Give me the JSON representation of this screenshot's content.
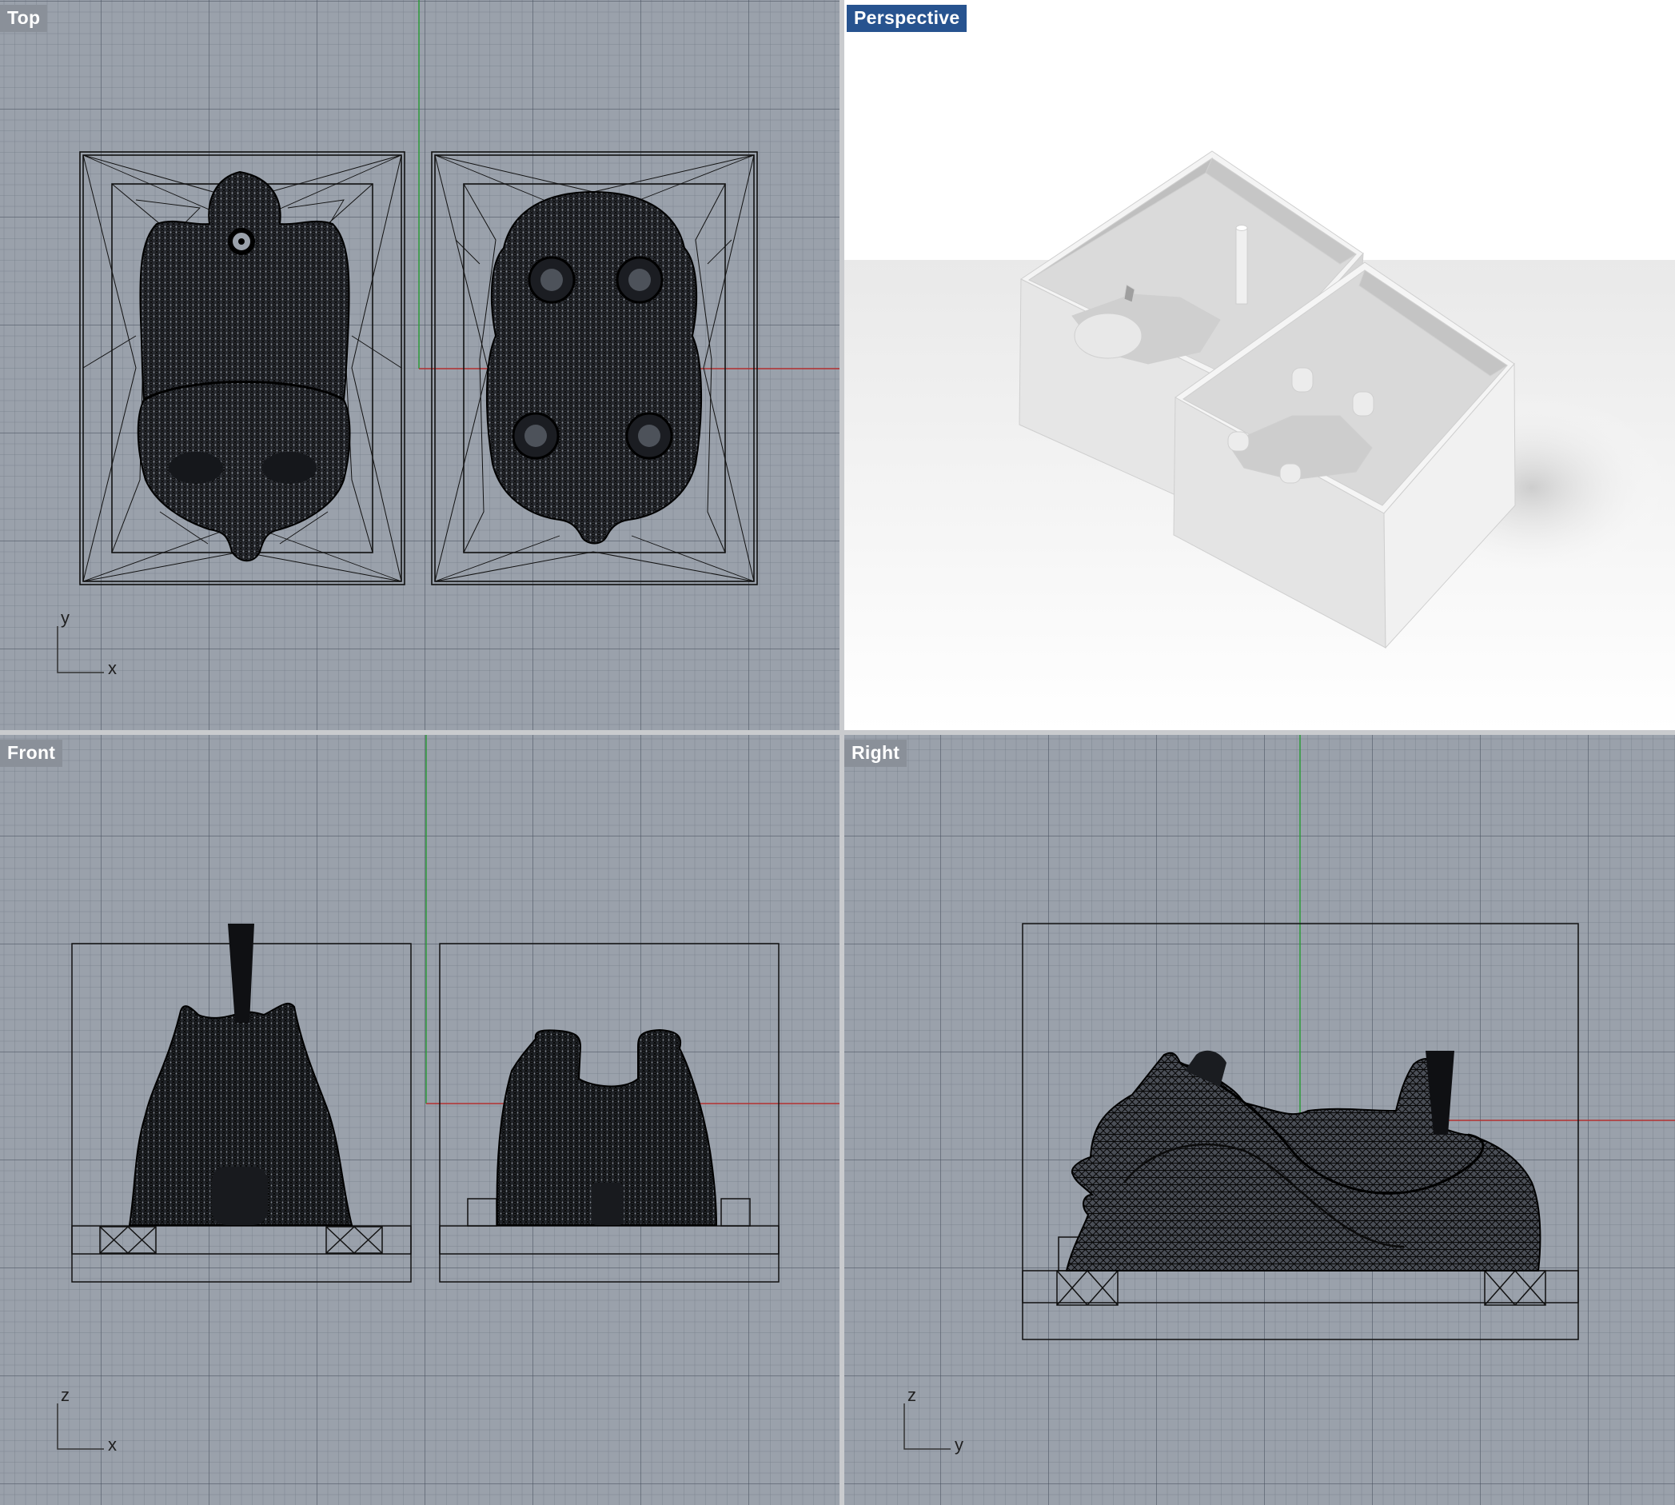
{
  "viewports": {
    "top": {
      "label": "Top",
      "axis_h": "x",
      "axis_v": "y"
    },
    "perspective": {
      "label": "Perspective"
    },
    "front": {
      "label": "Front",
      "axis_h": "x",
      "axis_v": "z"
    },
    "right": {
      "label": "Right",
      "axis_h": "y",
      "axis_v": "z"
    }
  },
  "colors": {
    "viewport_bg": "#9aa1ab",
    "active_tab": "#27538f",
    "inactive_tab": "#8a9099",
    "x_axis": "#b33030",
    "y_axis": "#2c9a3a",
    "wire": "#111111"
  }
}
